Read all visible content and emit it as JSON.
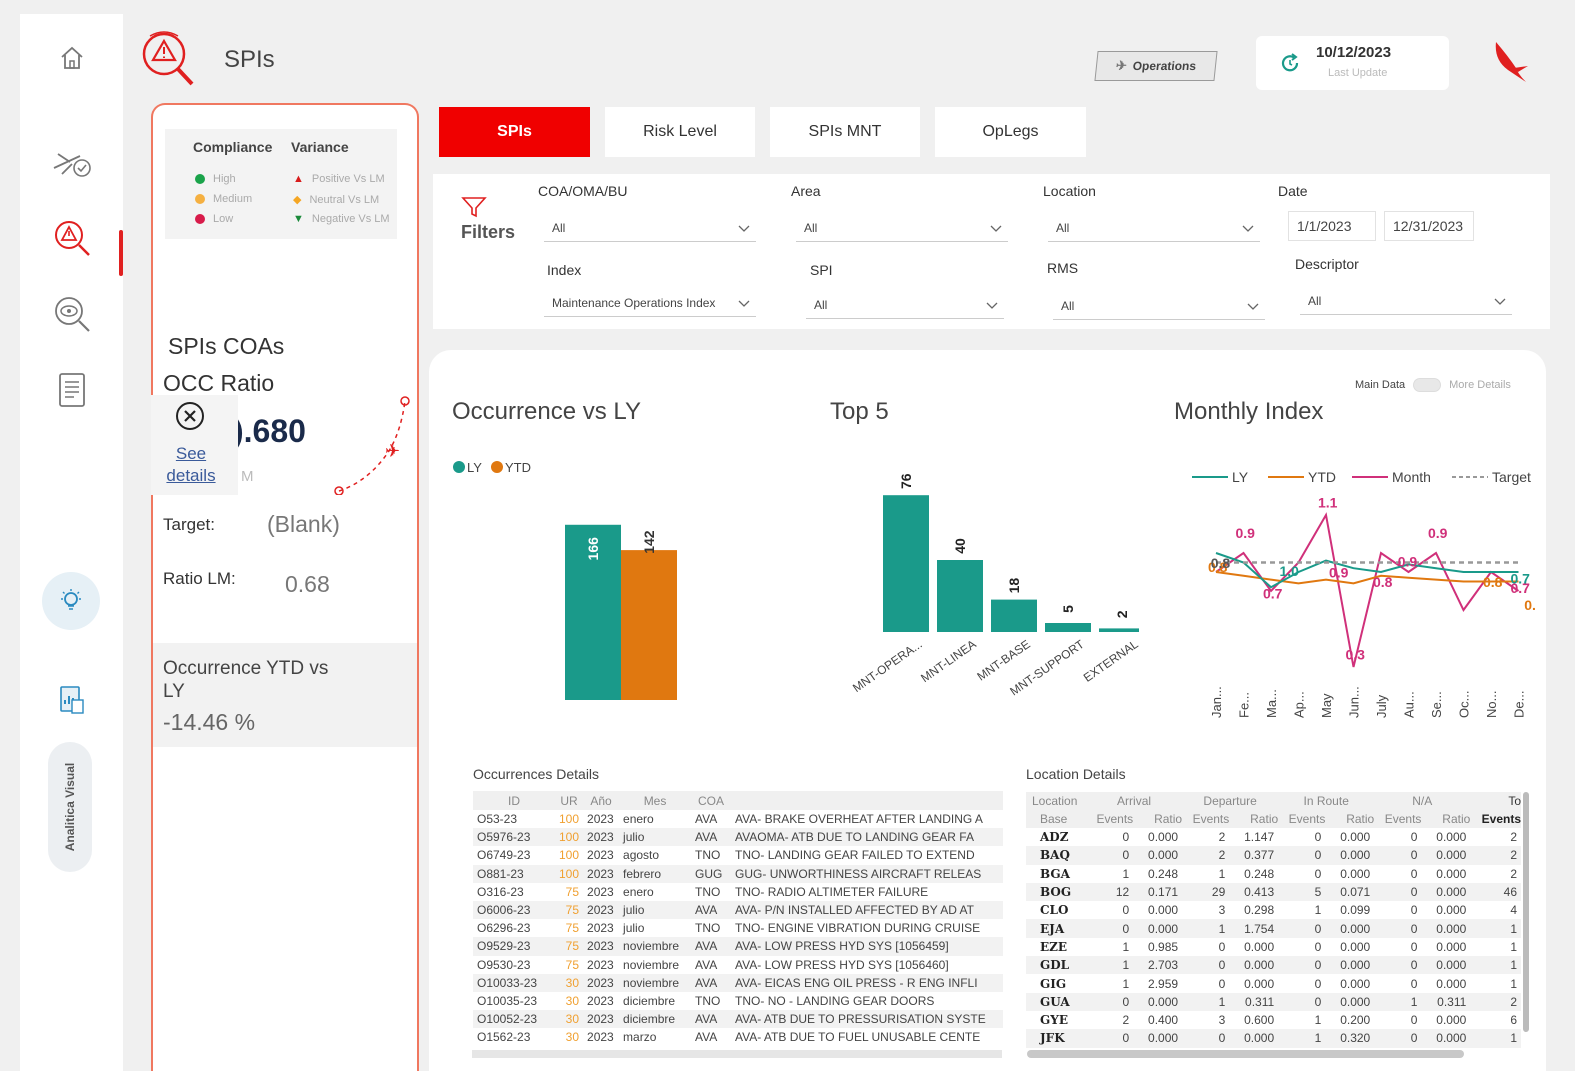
{
  "header": {
    "title": "SPIs",
    "operations_label": "Operations",
    "last_update_date": "10/12/2023",
    "last_update_label": "Last Update"
  },
  "rail": {
    "vertical_label": "Analitica Visual"
  },
  "legend": {
    "compliance_title": "Compliance",
    "variance_title": "Variance",
    "compliance": [
      {
        "label": "High",
        "color": "#1aa34a"
      },
      {
        "label": "Medium",
        "color": "#f5b041"
      },
      {
        "label": "Low",
        "color": "#d81b4a"
      }
    ],
    "variance": [
      {
        "label": "Positive Vs LM",
        "color": "#d81b1b"
      },
      {
        "label": "Neutral Vs LM",
        "color": "#f5a623"
      },
      {
        "label": "Negative Vs LM",
        "color": "#1a8a3a"
      }
    ]
  },
  "left_panel": {
    "coas_title": "SPIs COAs",
    "occ_ratio_title": "OCC Ratio",
    "big_value": ").680",
    "see_details": "See details",
    "m_label": "M",
    "target_label": "Target:",
    "target_value": "(Blank)",
    "ratio_lm_label": "Ratio LM:",
    "ratio_lm_value": "0.68",
    "occ_ytd_title": "Occurrence YTD vs LY",
    "occ_ytd_value": "-14.46 %"
  },
  "tabs": [
    {
      "label": "SPIs",
      "active": true
    },
    {
      "label": "Risk Level",
      "active": false
    },
    {
      "label": "SPIs MNT",
      "active": false
    },
    {
      "label": "OpLegs",
      "active": false
    }
  ],
  "filters": {
    "title": "Filters",
    "coa_label": "COA/OMA/BU",
    "coa_value": "All",
    "area_label": "Area",
    "area_value": "All",
    "location_label": "Location",
    "location_value": "All",
    "date_label": "Date",
    "date_from": "1/1/2023",
    "date_to": "12/31/2023",
    "index_label": "Index",
    "index_value": "Maintenance Operations Index",
    "spi_label": "SPI",
    "spi_value": "All",
    "rms_label": "RMS",
    "rms_value": "All",
    "descriptor_label": "Descriptor",
    "descriptor_value": "All"
  },
  "main": {
    "toggle_left": "Main Data",
    "toggle_right": "More Details",
    "occ_title": "Occurrence vs LY",
    "top5_title": "Top 5",
    "monthly_title": "Monthly Index"
  },
  "colors": {
    "teal": "#1a9a8a",
    "orange": "#e07810",
    "magenta": "#d0307a",
    "accent_red": "#f00000"
  },
  "chart_data": [
    {
      "type": "bar",
      "title": "Occurrence vs LY",
      "categories": [
        "LY",
        "YTD"
      ],
      "values": [
        166,
        142
      ],
      "legend": [
        "LY",
        "YTD"
      ],
      "legend_position": "top-left",
      "ylim": [
        0,
        180
      ]
    },
    {
      "type": "bar",
      "title": "Top 5",
      "categories": [
        "MNT-OPERA...",
        "MNT-LINEA",
        "MNT-BASE",
        "MNT-SUPPORT",
        "EXTERNAL"
      ],
      "values": [
        76,
        40,
        18,
        5,
        2
      ],
      "ylim": [
        0,
        80
      ]
    },
    {
      "type": "line",
      "title": "Monthly Index",
      "x": [
        "Jan...",
        "Fe...",
        "Ma...",
        "Ap...",
        "May",
        "Jun...",
        "July",
        "Au...",
        "Se...",
        "Oc...",
        "No...",
        "De..."
      ],
      "legend": [
        "LY",
        "YTD",
        "Month",
        "Target"
      ],
      "legend_position": "top",
      "series": [
        {
          "name": "Month",
          "values": [
            0.8,
            0.9,
            0.7,
            0.85,
            1.1,
            0.3,
            0.9,
            0.8,
            0.9,
            0.6,
            0.8,
            0.7
          ]
        },
        {
          "name": "YTD",
          "values": [
            0.8,
            0.78,
            0.76,
            0.74,
            0.76,
            0.74,
            0.78,
            0.77,
            0.76,
            0.75,
            0.75,
            0.75
          ]
        },
        {
          "name": "LY",
          "values": [
            0.9,
            0.85,
            0.72,
            0.8,
            0.86,
            0.82,
            0.8,
            0.84,
            0.82,
            0.8,
            0.8,
            0.8
          ]
        },
        {
          "name": "Target",
          "values": [
            0.85,
            0.85,
            0.85,
            0.85,
            0.85,
            0.85,
            0.85,
            0.85,
            0.85,
            0.85,
            0.85,
            0.85
          ]
        }
      ],
      "point_labels": [
        "0.8",
        "0.9",
        "0.7",
        "0.9",
        "1.1",
        "0.3",
        "0.9",
        "0.8",
        "0.9",
        "0.7",
        "0.8",
        "0.7",
        "0.8",
        "1.0",
        "0.7"
      ],
      "ylim": [
        0.2,
        1.2
      ]
    }
  ],
  "occ_table": {
    "title": "Occurrences Details",
    "headers": [
      "ID",
      "UR",
      "Año",
      "Mes",
      "COA",
      ""
    ],
    "rows": [
      [
        "O53-23",
        "100",
        "2023",
        "enero",
        "AVA",
        "AVA- BRAKE OVERHEAT AFTER LANDING A"
      ],
      [
        "O5976-23",
        "100",
        "2023",
        "julio",
        "AVA",
        "AVAOMA- ATB DUE TO LANDING GEAR FA"
      ],
      [
        "O6749-23",
        "100",
        "2023",
        "agosto",
        "TNO",
        "TNO- LANDING GEAR FAILED TO EXTEND"
      ],
      [
        "O881-23",
        "100",
        "2023",
        "febrero",
        "GUG",
        "GUG- UNWORTHINESS AIRCRAFT RELEAS"
      ],
      [
        "O316-23",
        "75",
        "2023",
        "enero",
        "TNO",
        "TNO- RADIO ALTIMETER FAILURE"
      ],
      [
        "O6006-23",
        "75",
        "2023",
        "julio",
        "AVA",
        "AVA- P/N INSTALLED AFFECTED BY AD AT"
      ],
      [
        "O6296-23",
        "75",
        "2023",
        "julio",
        "TNO",
        "TNO- ENGINE VIBRATION DURING CRUISE"
      ],
      [
        "O9529-23",
        "75",
        "2023",
        "noviembre",
        "AVA",
        "AVA- LOW PRESS HYD SYS [1056459]"
      ],
      [
        "O9530-23",
        "75",
        "2023",
        "noviembre",
        "AVA",
        "AVA- LOW PRESS HYD SYS [1056460]"
      ],
      [
        "O10033-23",
        "30",
        "2023",
        "noviembre",
        "AVA",
        "AVA- EICAS ENG OIL PRESS - R ENG INFLI"
      ],
      [
        "O10035-23",
        "30",
        "2023",
        "diciembre",
        "TNO",
        "TNO- NO - LANDING GEAR DOORS"
      ],
      [
        "O10052-23",
        "30",
        "2023",
        "diciembre",
        "AVA",
        "AVA- ATB DUE TO PRESSURISATION SYSTE"
      ],
      [
        "O1562-23",
        "30",
        "2023",
        "marzo",
        "AVA",
        "AVA- ATB DUE TO FUEL UNUSABLE CENTE"
      ]
    ]
  },
  "loc_table": {
    "title": "Location Details",
    "group_headers": [
      "Location",
      "Arrival",
      "Departure",
      "In Route",
      "N/A",
      "To"
    ],
    "sub_headers": [
      "Base",
      "Events",
      "Ratio",
      "Events",
      "Ratio",
      "Events",
      "Ratio",
      "Events",
      "Ratio",
      "Events"
    ],
    "rows": [
      [
        "ADZ",
        "0",
        "0.000",
        "2",
        "1.147",
        "0",
        "0.000",
        "0",
        "0.000",
        "2"
      ],
      [
        "BAQ",
        "0",
        "0.000",
        "2",
        "0.377",
        "0",
        "0.000",
        "0",
        "0.000",
        "2"
      ],
      [
        "BGA",
        "1",
        "0.248",
        "1",
        "0.248",
        "0",
        "0.000",
        "0",
        "0.000",
        "2"
      ],
      [
        "BOG",
        "12",
        "0.171",
        "29",
        "0.413",
        "5",
        "0.071",
        "0",
        "0.000",
        "46"
      ],
      [
        "CLO",
        "0",
        "0.000",
        "3",
        "0.298",
        "1",
        "0.099",
        "0",
        "0.000",
        "4"
      ],
      [
        "EJA",
        "0",
        "0.000",
        "1",
        "1.754",
        "0",
        "0.000",
        "0",
        "0.000",
        "1"
      ],
      [
        "EZE",
        "1",
        "0.985",
        "0",
        "0.000",
        "0",
        "0.000",
        "0",
        "0.000",
        "1"
      ],
      [
        "GDL",
        "1",
        "2.703",
        "0",
        "0.000",
        "0",
        "0.000",
        "0",
        "0.000",
        "1"
      ],
      [
        "GIG",
        "1",
        "2.959",
        "0",
        "0.000",
        "0",
        "0.000",
        "0",
        "0.000",
        "1"
      ],
      [
        "GUA",
        "0",
        "0.000",
        "1",
        "0.311",
        "0",
        "0.000",
        "1",
        "0.311",
        "2"
      ],
      [
        "GYE",
        "2",
        "0.400",
        "3",
        "0.600",
        "1",
        "0.200",
        "0",
        "0.000",
        "6"
      ],
      [
        "JFK",
        "0",
        "0.000",
        "0",
        "0.000",
        "1",
        "0.320",
        "0",
        "0.000",
        "1"
      ]
    ]
  }
}
